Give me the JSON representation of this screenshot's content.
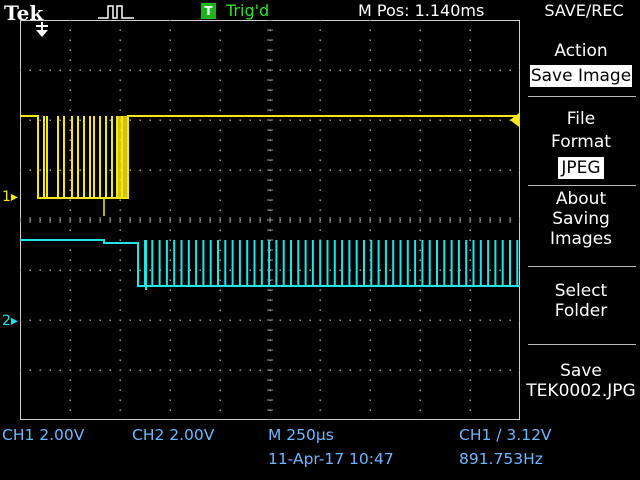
{
  "header": {
    "brand": "Tek",
    "trigger_badge": "T",
    "trigger_status": "Trig'd",
    "horizontal_position": "M Pos: 1.140ms",
    "menu_title": "SAVE/REC"
  },
  "side_menu": {
    "action_label": "Action",
    "action_value": "Save Image",
    "file_format_line1": "File",
    "file_format_line2": "Format",
    "file_format_value": "JPEG",
    "about_line1": "About",
    "about_line2": "Saving",
    "about_line3": "Images",
    "select_line1": "Select",
    "select_line2": "Folder",
    "save_line1": "Save",
    "save_line2": "TEK0002.JPG"
  },
  "channel_markers": {
    "ch1": "1",
    "ch2": "2"
  },
  "status_bar": {
    "ch1_scale": "CH1  2.00V",
    "ch2_scale": "CH2  2.00V",
    "timebase": "M 250µs",
    "datetime": "11-Apr-17 10:47",
    "trigger": "CH1  ∕  3.12V",
    "frequency": "891.753Hz"
  },
  "colors": {
    "ch1": "#f5e614",
    "ch2": "#1ee6e6",
    "trigger_badge": "#1db31d",
    "status_blue": "#6fb7ff"
  },
  "icons": {
    "trigger_position": "trigger-position-arrow-icon",
    "pulse_trigger": "pulse-trigger-icon"
  }
}
